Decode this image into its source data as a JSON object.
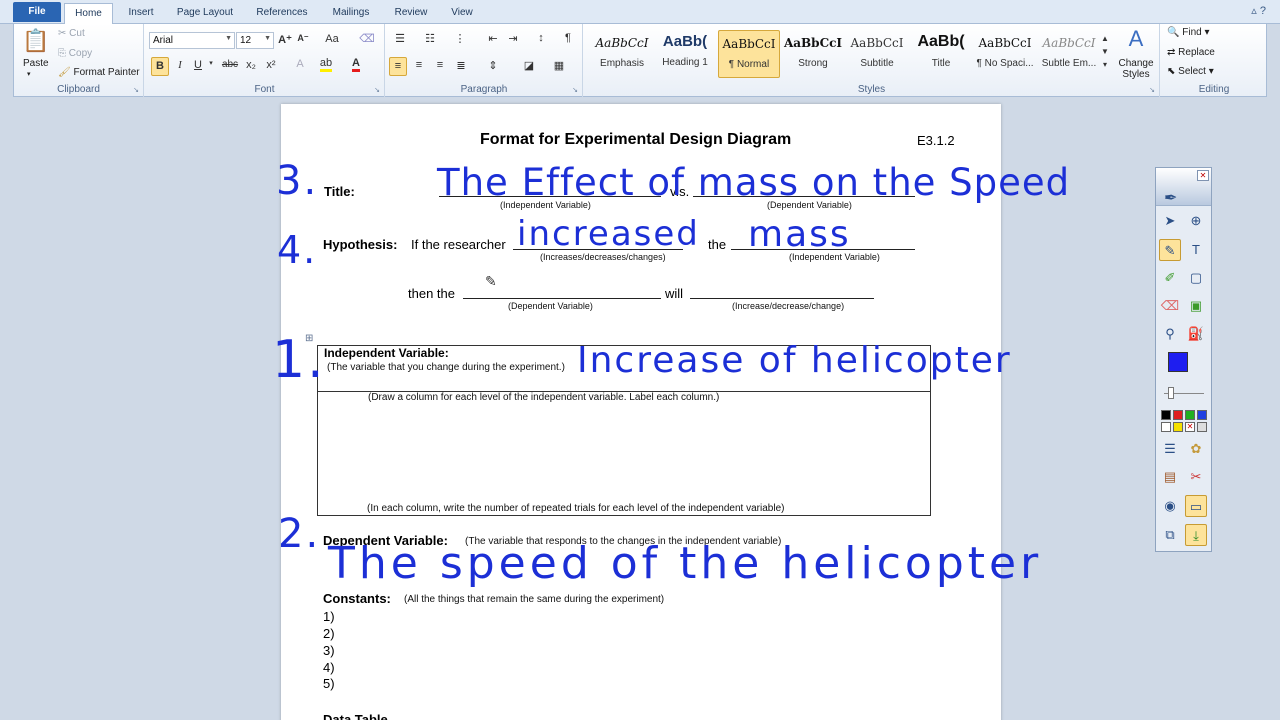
{
  "tabs": [
    "File",
    "Home",
    "Insert",
    "Page Layout",
    "References",
    "Mailings",
    "Review",
    "View"
  ],
  "clipboard": {
    "paste": "Paste",
    "cut": "Cut",
    "copy": "Copy",
    "format_painter": "Format Painter",
    "group": "Clipboard"
  },
  "font": {
    "name": "Arial",
    "size": "12",
    "group": "Font",
    "bold": "B",
    "italic": "I",
    "underline": "U",
    "strike": "abc",
    "sub": "x₂",
    "sup": "x²",
    "grow": "A⁺",
    "shrink": "A⁻",
    "case": "Aa"
  },
  "paragraph": {
    "group": "Paragraph",
    "pilcrow": "¶"
  },
  "styles": {
    "group": "Styles",
    "items": [
      {
        "preview": "AaBbCcI",
        "name": "Emphasis"
      },
      {
        "preview": "AaBb(",
        "name": "Heading 1"
      },
      {
        "preview": "AaBbCcI",
        "name": "¶ Normal"
      },
      {
        "preview": "AaBbCcI",
        "name": "Strong"
      },
      {
        "preview": "AaBbCcI",
        "name": "Subtitle"
      },
      {
        "preview": "AaBb(",
        "name": "Title"
      },
      {
        "preview": "AaBbCcI",
        "name": "¶ No Spaci..."
      },
      {
        "preview": "AaBbCcI",
        "name": "Subtle Em..."
      }
    ],
    "change_styles": "Change Styles"
  },
  "editing": {
    "group": "Editing",
    "find": "Find",
    "replace": "Replace",
    "select": "Select"
  },
  "document": {
    "title": "Format for Experimental Design Diagram",
    "code": "E3.1.2",
    "title_label": "Title:",
    "vs": "v.s.",
    "cap_independent": "(Independent Variable)",
    "cap_dependent": "(Dependent Variable)",
    "hypothesis_label": "Hypothesis:",
    "hyp_text1": "If the researcher",
    "hyp_the": "the",
    "cap_increases": "(Increases/decreases/changes)",
    "hyp_then": "then the",
    "hyp_will": "will",
    "cap_increase": "(Increase/decrease/change)",
    "iv_label": "Independent Variable:",
    "iv_desc": "(The variable that you change during the experiment.)",
    "iv_columns": "(Draw a column for each level of the independent variable.  Label each column.)",
    "iv_trials": "(In each column, write the number of repeated trials for each level of the independent variable)",
    "dv_label": "Dependent Variable:",
    "dv_desc": "(The variable that responds to the changes in the independent variable)",
    "const_label": "Constants:",
    "const_desc": "(All the things that remain the same during the experiment)",
    "constants": [
      "1)",
      "2)",
      "3)",
      "4)",
      "5)"
    ],
    "data_table": "Data Table"
  },
  "handwriting": {
    "n3": "3.",
    "title_ink": "The Effect of mass on the Speed",
    "n4": "4.",
    "increased": "increased",
    "mass": "mass",
    "n1": "1.",
    "iv_ink": "Increase of helicopter",
    "n2": "2.",
    "dv_ink": "The speed of the helicopter"
  },
  "colors": {
    "ink": "#1c2fd6",
    "accent": "#2a65b3"
  }
}
